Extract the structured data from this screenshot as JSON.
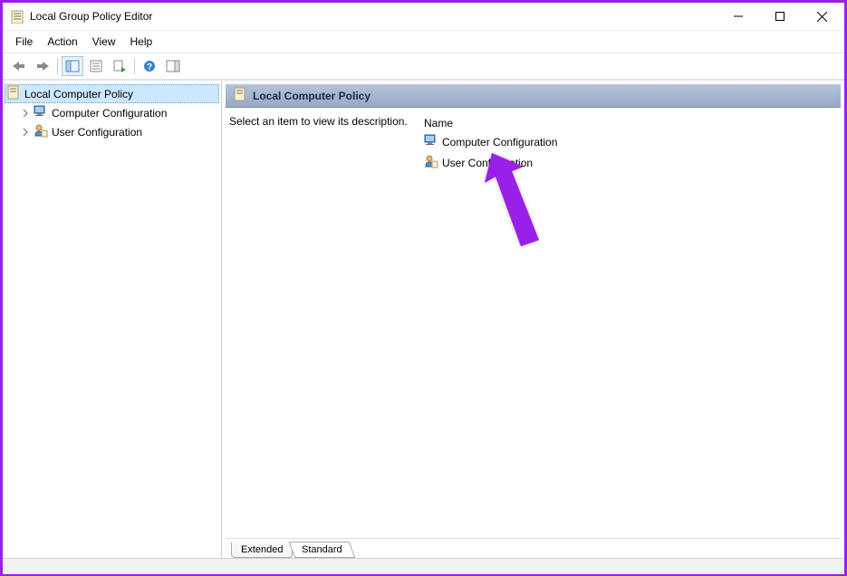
{
  "window": {
    "title": "Local Group Policy Editor"
  },
  "menubar": {
    "items": [
      "File",
      "Action",
      "View",
      "Help"
    ]
  },
  "toolbar": {
    "buttons": [
      "back",
      "forward",
      "show-hide-tree",
      "properties",
      "export",
      "help",
      "show-hide-action"
    ]
  },
  "tree": {
    "root": {
      "label": "Local Computer Policy",
      "selected": true
    },
    "children": [
      {
        "label": "Computer Configuration",
        "icon": "computer-config-icon"
      },
      {
        "label": "User Configuration",
        "icon": "user-config-icon"
      }
    ]
  },
  "details": {
    "header": "Local Computer Policy",
    "description_prompt": "Select an item to view its description.",
    "columns": {
      "name": "Name"
    },
    "items": [
      {
        "label": "Computer Configuration",
        "icon": "computer-config-icon"
      },
      {
        "label": "User Configuration",
        "icon": "user-config-icon"
      }
    ]
  },
  "tabs": {
    "extended": "Extended",
    "standard": "Standard"
  },
  "colors": {
    "accent_border": "#9a1fe8",
    "selection": "#cce8ff"
  }
}
